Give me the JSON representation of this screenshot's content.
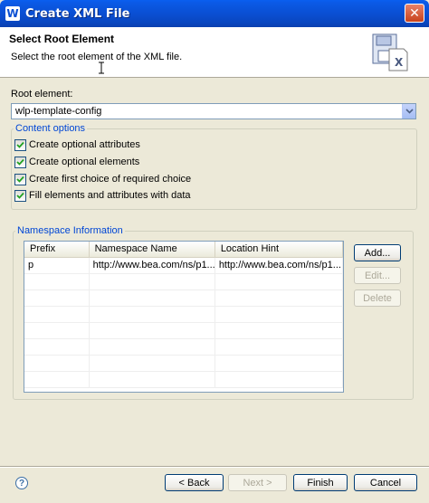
{
  "window": {
    "title": "Create XML File",
    "app_icon": "W",
    "close_glyph": "✕"
  },
  "banner": {
    "title": "Select Root Element",
    "description": "Select the root element of the XML file.",
    "image_icon": "xml-file-wizard-icon"
  },
  "root_element": {
    "label": "Root element:",
    "value": "wlp-template-config"
  },
  "content_options": {
    "legend": "Content options",
    "items": [
      {
        "label": "Create optional attributes",
        "checked": true
      },
      {
        "label": "Create optional elements",
        "checked": true
      },
      {
        "label": "Create first choice of required choice",
        "checked": true
      },
      {
        "label": "Fill elements and attributes with data",
        "checked": true
      }
    ]
  },
  "namespace": {
    "legend": "Namespace Information",
    "columns": [
      "Prefix",
      "Namespace Name",
      "Location Hint"
    ],
    "rows": [
      {
        "prefix": "p",
        "name": "http://www.bea.com/ns/p1...",
        "hint": "http://www.bea.com/ns/p1..."
      }
    ],
    "buttons": {
      "add": "Add...",
      "edit": "Edit...",
      "delete": "Delete"
    }
  },
  "footer": {
    "help": "?",
    "back": "< Back",
    "next": "Next >",
    "finish": "Finish",
    "cancel": "Cancel"
  }
}
